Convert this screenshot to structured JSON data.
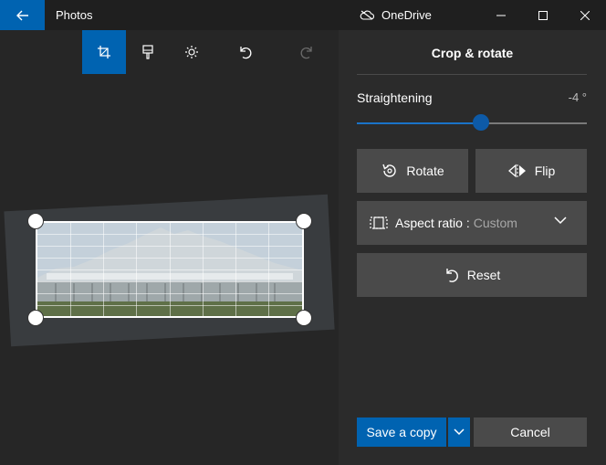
{
  "window": {
    "app_title": "Photos",
    "onedrive_label": "OneDrive",
    "controls": [
      "minimize",
      "maximize",
      "close"
    ]
  },
  "toolbar": {
    "tools": [
      {
        "name": "crop",
        "icon": "crop-icon",
        "active": true
      },
      {
        "name": "filters",
        "icon": "brush-icon",
        "active": false
      },
      {
        "name": "adjustments",
        "icon": "brightness-icon",
        "active": false
      },
      {
        "name": "undo",
        "icon": "undo-icon",
        "active": false
      },
      {
        "name": "redo",
        "icon": "redo-icon",
        "active": false
      }
    ]
  },
  "panel": {
    "title": "Crop & rotate",
    "straightening": {
      "label": "Straightening",
      "value_text": "-4 °",
      "value": -4,
      "fraction": 0.54
    },
    "rotate_label": "Rotate",
    "flip_label": "Flip",
    "aspect_label": "Aspect ratio :",
    "aspect_value": "Custom",
    "reset_label": "Reset",
    "save_label": "Save a copy",
    "cancel_label": "Cancel"
  },
  "colors": {
    "accent": "#0063b1",
    "panel_bg": "#2b2b2b",
    "button_bg": "#4a4a4a"
  }
}
